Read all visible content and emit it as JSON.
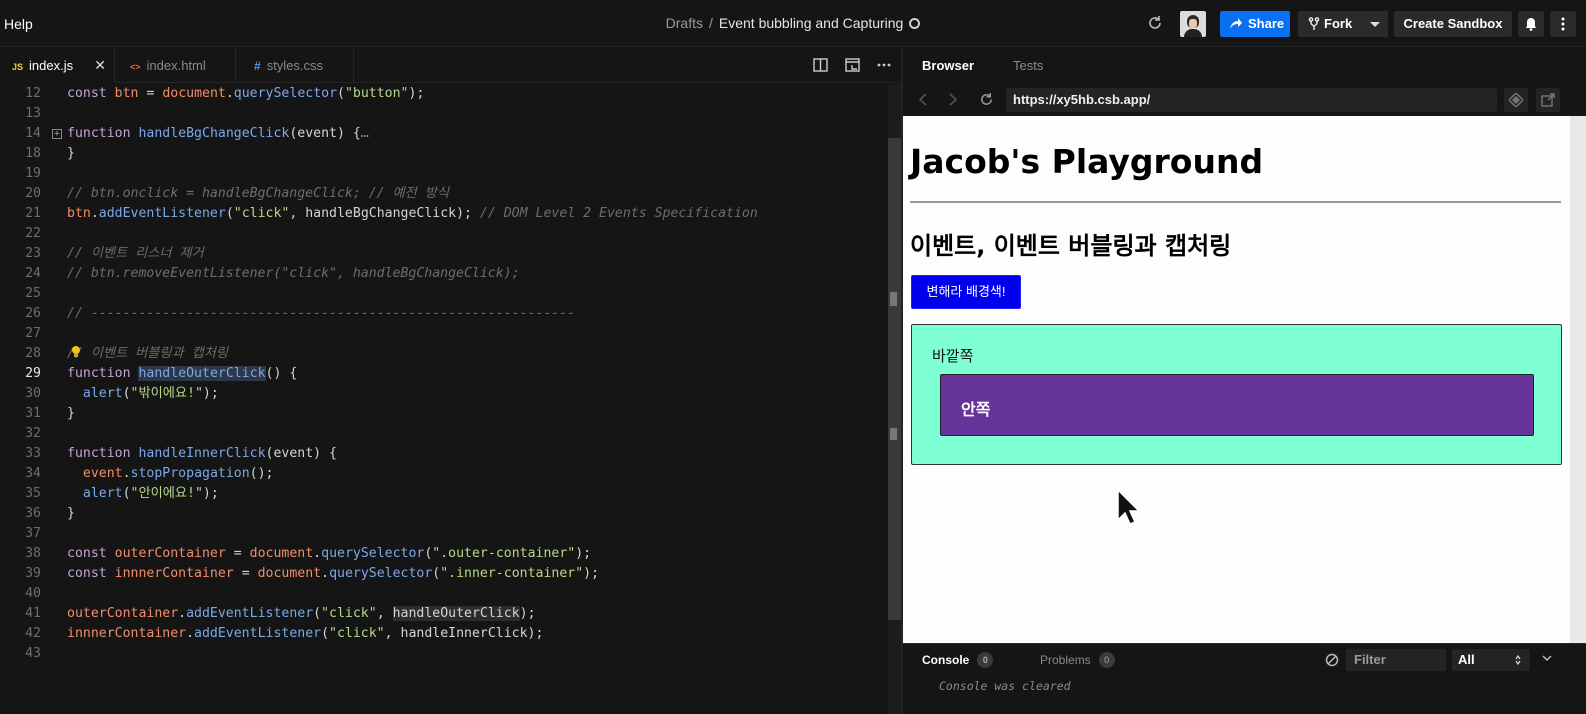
{
  "topbar": {
    "help_label": "Help",
    "drafts_label": "Drafts",
    "separator": "/",
    "sandbox_title": "Event bubbling and Capturing",
    "share_label": "Share",
    "fork_label": "Fork",
    "create_sandbox_label": "Create Sandbox"
  },
  "editor_tabs": [
    {
      "icon_text": "JS",
      "label": "index.js",
      "active": true
    },
    {
      "icon_text": "<>",
      "label": "index.html",
      "active": false
    },
    {
      "icon_text": "#",
      "label": "styles.css",
      "active": false
    }
  ],
  "code": {
    "current_line": 29,
    "lines": [
      {
        "n": "12",
        "text": "const btn = document.querySelector(\"button\");"
      },
      {
        "n": "13",
        "text": ""
      },
      {
        "n": "14",
        "text": "function handleBgChangeClick(event) {…"
      },
      {
        "n": "18",
        "text": "}"
      },
      {
        "n": "19",
        "text": ""
      },
      {
        "n": "20",
        "text": "// btn.onclick = handleBgChangeClick; // 예전 방식"
      },
      {
        "n": "21",
        "text": "btn.addEventListener(\"click\", handleBgChangeClick); // DOM Level 2 Events Specification"
      },
      {
        "n": "22",
        "text": ""
      },
      {
        "n": "23",
        "text": "// 이벤트 리스너 제거"
      },
      {
        "n": "24",
        "text": "// btn.removeEventListener(\"click\", handleBgChangeClick);"
      },
      {
        "n": "25",
        "text": ""
      },
      {
        "n": "26",
        "text": "// -------------------------------------------------------------"
      },
      {
        "n": "27",
        "text": ""
      },
      {
        "n": "28",
        "text": "// 이벤트 버블링과 캡처링"
      },
      {
        "n": "29",
        "text": "function handleOuterClick() {"
      },
      {
        "n": "30",
        "text": "  alert(\"밖이에요!\");"
      },
      {
        "n": "31",
        "text": "}"
      },
      {
        "n": "32",
        "text": ""
      },
      {
        "n": "33",
        "text": "function handleInnerClick(event) {"
      },
      {
        "n": "34",
        "text": "  event.stopPropagation();"
      },
      {
        "n": "35",
        "text": "  alert(\"안이에요!\");"
      },
      {
        "n": "36",
        "text": "}"
      },
      {
        "n": "37",
        "text": ""
      },
      {
        "n": "38",
        "text": "const outerContainer = document.querySelector(\".outer-container\");"
      },
      {
        "n": "39",
        "text": "const innnerContainer = document.querySelector(\".inner-container\");"
      },
      {
        "n": "40",
        "text": ""
      },
      {
        "n": "41",
        "text": "outerContainer.addEventListener(\"click\", handleOuterClick);"
      },
      {
        "n": "42",
        "text": "innnerContainer.addEventListener(\"click\", handleInnerClick);"
      },
      {
        "n": "43",
        "text": ""
      }
    ]
  },
  "browser": {
    "tabs": [
      {
        "label": "Browser",
        "active": true
      },
      {
        "label": "Tests",
        "active": false
      }
    ],
    "url": "https://xy5hb.csb.app/",
    "page": {
      "h1": "Jacob's Playground",
      "h2": "이벤트, 이벤트 버블링과 캡처링",
      "button_label": "변해라 배경색!",
      "outer_label": "바깥쪽",
      "inner_label": "안쪽"
    }
  },
  "console": {
    "tab_console": "Console",
    "console_count": "0",
    "tab_problems": "Problems",
    "problems_count": "0",
    "filter_placeholder": "Filter",
    "level_value": "All",
    "message": "Console was cleared"
  },
  "colors": {
    "accent_blue": "#0971f1",
    "outer_box": "#7fffd4",
    "inner_box": "#663399",
    "page_button": "#0000ee"
  },
  "icons": [
    "globe-icon",
    "reload-icon",
    "share-icon",
    "fork-icon",
    "bell-icon",
    "more-icon",
    "split-view-icon",
    "preview-icon",
    "back-icon",
    "forward-icon",
    "open-external-icon",
    "codesandbox-icon",
    "clear-console-icon",
    "lightbulb-icon",
    "mouse-cursor-icon"
  ]
}
